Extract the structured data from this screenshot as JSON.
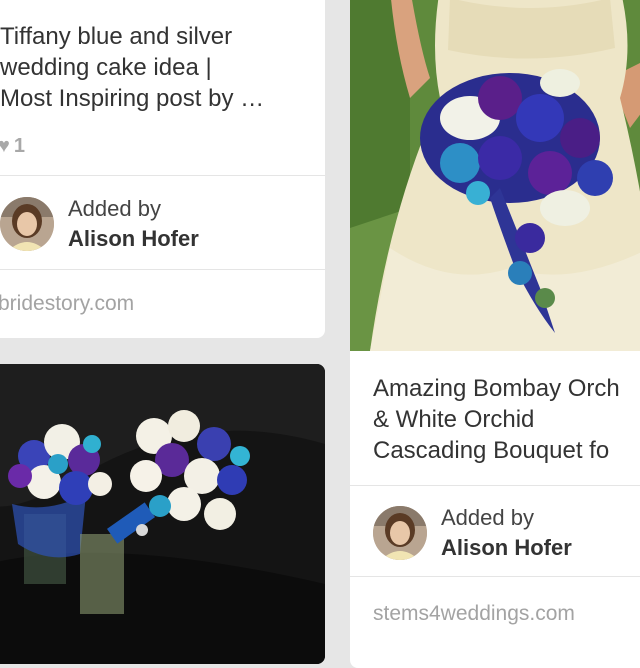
{
  "pins": {
    "cake_pin": {
      "title_lines": [
        "Tiffany blue and silver",
        "wedding cake idea |",
        "Most Inspiring post by …"
      ],
      "likes": "1",
      "added_by_label": "Added by",
      "user_name": "Alison Hofer",
      "source": "bridestory.com"
    },
    "bouquet_pin": {
      "title_lines": [
        "Amazing Bombay Orch",
        "& White Orchid",
        "Cascading Bouquet fo"
      ],
      "added_by_label": "Added by",
      "user_name": "Alison Hofer",
      "source": "stems4weddings.com"
    }
  },
  "icons": {
    "like": "heart-icon"
  },
  "colors": {
    "background": "#e6e6e6",
    "card": "#ffffff",
    "muted_text": "#a3a3a3",
    "orchid_blue": "#2b2fa6",
    "orchid_purple": "#5a1f8a"
  }
}
